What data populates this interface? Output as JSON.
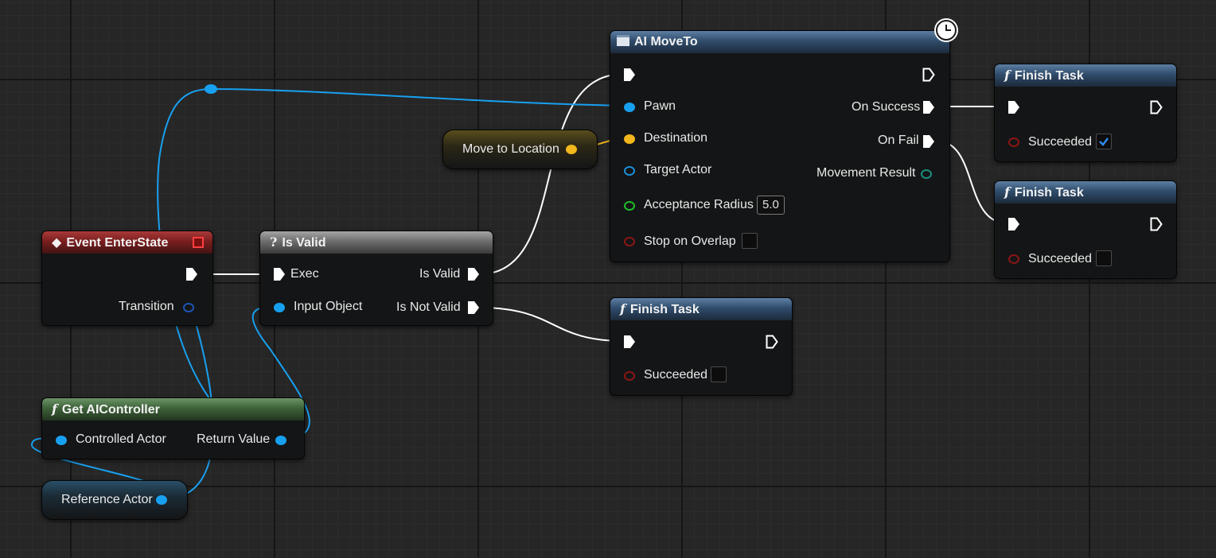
{
  "nodes": {
    "event_enter_state": {
      "title": "Event EnterState",
      "transition_label": "Transition"
    },
    "is_valid": {
      "title": "Is Valid",
      "exec_label": "Exec",
      "input_object_label": "Input Object",
      "is_valid_label": "Is Valid",
      "is_not_valid_label": "Is Not Valid"
    },
    "get_aicontroller": {
      "title": "Get AIController",
      "controlled_actor_label": "Controlled Actor",
      "return_value_label": "Return Value"
    },
    "reference_actor": {
      "label": "Reference Actor"
    },
    "move_to_location": {
      "label": "Move to Location"
    },
    "ai_moveto": {
      "title": "AI MoveTo",
      "pawn_label": "Pawn",
      "destination_label": "Destination",
      "target_actor_label": "Target Actor",
      "acceptance_radius_label": "Acceptance Radius",
      "acceptance_radius_value": "5.0",
      "stop_on_overlap_label": "Stop on Overlap",
      "stop_on_overlap_checked": false,
      "on_success_label": "On Success",
      "on_fail_label": "On Fail",
      "movement_result_label": "Movement Result"
    },
    "finish_task_success": {
      "title": "Finish Task",
      "succeeded_label": "Succeeded",
      "succeeded_checked": true
    },
    "finish_task_fail": {
      "title": "Finish Task",
      "succeeded_label": "Succeeded",
      "succeeded_checked": false
    },
    "finish_task_invalid": {
      "title": "Finish Task",
      "succeeded_label": "Succeeded",
      "succeeded_checked": false
    }
  },
  "icons": {
    "function": "function-icon",
    "event": "event-diamond-icon",
    "question": "question-icon",
    "latent": "clock-icon",
    "macro": "moveto-icon"
  },
  "colors": {
    "exec": "#ffffff",
    "object": "#18a0f0",
    "vector": "#f1b71c",
    "float": "#1fbf2c",
    "bool": "#8c1616",
    "enum": "#1a8f80"
  }
}
